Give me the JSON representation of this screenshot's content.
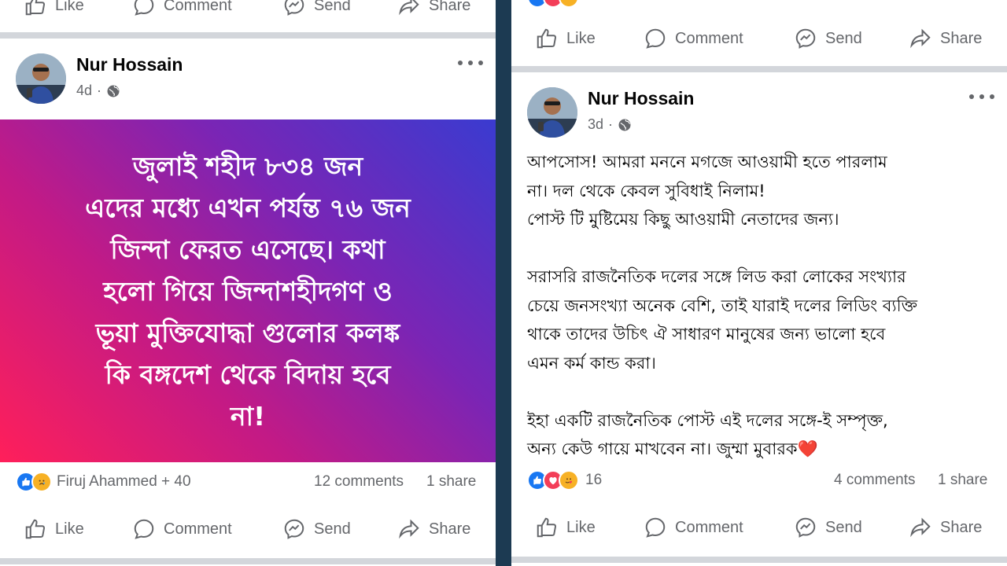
{
  "actions": {
    "like": "Like",
    "comment": "Comment",
    "send": "Send",
    "share": "Share"
  },
  "left_post": {
    "author": "Nur Hossain",
    "time": "4d",
    "privacy_icon": "globe-icon",
    "banner_lines": [
      "জুলাই শহীদ ৮৩৪ জন",
      "এদের মধ্যে এখন পর্যন্ত ৭৬ জন",
      "জিন্দা ফেরত এসেছে। কথা",
      "হলো গিয়ে জিন্দাশহীদগণ ও",
      "ভূয়া মুক্তিযোদ্ধা গুলোর কলঙ্ক",
      "কি বঙ্গদেশ থেকে বিদায় হবে",
      "না!"
    ],
    "reactions_text": "Firuj Ahammed + 40",
    "comments": "12 comments",
    "shares": "1 share",
    "banner_colors": [
      "#ff1f5a",
      "#7a25b5",
      "#3a3bd0"
    ]
  },
  "right_post": {
    "author": "Nur Hossain",
    "time": "3d",
    "privacy_icon": "globe-icon",
    "paragraphs": [
      [
        "আপসোস! আমরা মননে মগজে আওয়ামী হতে পারলাম",
        "না। দল থেকে কেবল সুবিধাই নিলাম!",
        " পোস্ট টি মুষ্টিমেয় কিছু আওয়ামী নেতাদের জন্য।"
      ],
      [
        "সরাসরি রাজনৈতিক দলের সঙ্গে লিড করা লোকের সংখ্যার",
        "চেয়ে জনসংখ্যা অনেক বেশি, তাই যারাই দলের লিডিং ব্যক্তি",
        "থাকে তাদের উচিৎ ঐ সাধারণ মানুষের জন্য ভালো হবে",
        "এমন কর্ম কান্ড করা।"
      ],
      [
        "ইহা একটি রাজনৈতিক পোস্ট এই দলের সঙ্গে-ই সম্পৃক্ত,",
        "অন্য কেউ গায়ে মাখবেন না। জুম্মা মুবারক❤️"
      ]
    ],
    "reactions_count": "16",
    "comments": "4 comments",
    "shares": "1 share"
  },
  "colors": {
    "action_gray": "#65676b",
    "like_blue": "#1877f2",
    "love_red": "#f33e58",
    "care_yellow": "#f7b125"
  }
}
